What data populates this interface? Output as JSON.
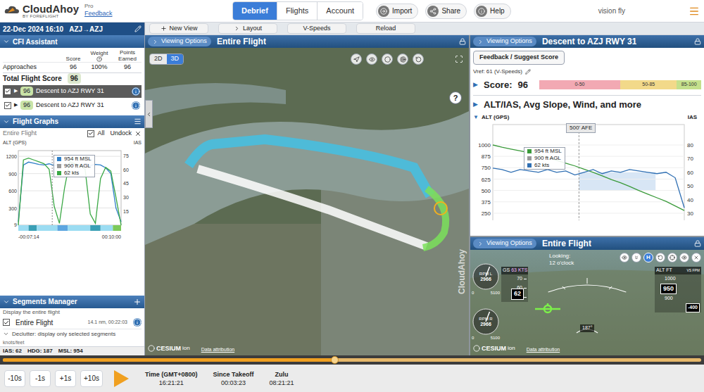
{
  "header": {
    "logo": "CloudAhoy",
    "logo_sub": "BY FOREFLIGHT",
    "edition": "Pro",
    "feedback_link": "Feedback",
    "tabs": [
      {
        "label": "Debrief",
        "selected": true
      },
      {
        "label": "Flights",
        "selected": false
      },
      {
        "label": "Account",
        "selected": false
      }
    ],
    "buttons": [
      "Import",
      "Share",
      "Help"
    ],
    "user": "vision fly"
  },
  "toolbar": [
    "New View",
    "Layout",
    "V-Speeds",
    "Reload"
  ],
  "sidebar": {
    "flight_title": "22-Dec 2024 16:10",
    "route": "AZJ→AZJ",
    "cfi": {
      "title": "CFI Assistant",
      "columns": [
        "Score",
        "Weight",
        "Points Earned"
      ],
      "rows": [
        {
          "label": "Approaches",
          "score": "96",
          "weight": "100%",
          "points": "96"
        }
      ],
      "total": {
        "label": "Total Flight Score",
        "score": "96"
      },
      "segments": [
        {
          "score": "96",
          "label": "Descent to AZJ RWY 31",
          "checked": true,
          "selected": true,
          "expander": "▶"
        },
        {
          "score": "96",
          "label": "Descent to AZJ RWY 31",
          "checked": true,
          "selected": false,
          "expander": "▶"
        }
      ]
    },
    "graphs": {
      "title": "Flight Graphs",
      "filter": "Entire Flight",
      "all": {
        "label": "All",
        "checked": true
      },
      "undock": "Undock",
      "left_axis": "ALT (GPS)",
      "right_axis": "IAS",
      "left_ticks": [
        "1200",
        "900",
        "600",
        "300",
        "9"
      ],
      "right_ticks": [
        "75",
        "60",
        "45",
        "30",
        "15"
      ],
      "x_labels": [
        "-00:07:14",
        "00:10:00"
      ],
      "series": [
        {
          "name": "ALT",
          "color": "#2f7fc8",
          "values": [
            60,
            1050,
            1100,
            1080,
            1060,
            1050,
            1070,
            1040,
            1060,
            1050,
            1030,
            1060,
            1050,
            1070,
            1040,
            1060,
            1050,
            1000,
            900,
            300,
            60
          ]
        },
        {
          "name": "IAS",
          "color": "#3aa845",
          "values": [
            0,
            70,
            72,
            70,
            68,
            66,
            60,
            20,
            2,
            40,
            68,
            66,
            64,
            60,
            12,
            2,
            50,
            62,
            58,
            30,
            0
          ]
        }
      ],
      "tooltip": [
        "954 ft MSL",
        "900 ft AGL",
        "62 kts"
      ],
      "phases": [
        {
          "color": "#9bdcf2",
          "level": 0.1
        },
        {
          "color": "#3a9fb5",
          "level": 0.08
        },
        {
          "color": "#9bdcf2",
          "level": 0.2
        },
        {
          "color": "#5da6e0",
          "level": 0.1
        },
        {
          "color": "#9bdcf2",
          "level": 0.22
        },
        {
          "color": "#3a9fb5",
          "level": 0.1
        },
        {
          "color": "#9bdcf2",
          "level": 0.12
        },
        {
          "color": "#7cc95a",
          "level": 0.08
        }
      ]
    },
    "segments_manager": {
      "title": "Segments Manager",
      "hint": "Display the entire flight",
      "segments": [
        {
          "label": "Entire Flight",
          "detail": "14.1 nm, 00:22:03",
          "checked": true
        }
      ],
      "declutter": "Declutter: display only selected segments",
      "units": "knots/feet"
    },
    "status": [
      {
        "label": "IAS:",
        "value": "62"
      },
      {
        "label": "HDG:",
        "value": "187"
      },
      {
        "label": "MSL:",
        "value": "954"
      }
    ]
  },
  "map_view": {
    "viewing_options": "Viewing Options",
    "title": "Entire Flight",
    "modes": [
      {
        "label": "2D",
        "selected": false
      },
      {
        "label": "3D",
        "selected": true
      }
    ],
    "help": "?",
    "provider": "CESIUM",
    "provider_sub": "ion",
    "attribution": "Data attribution",
    "watermark": "CloudAhoy"
  },
  "score_view": {
    "viewing_options": "Viewing Options",
    "title": "Descent to AZJ RWY 31",
    "feedback_button": "Feedback / Suggest Score",
    "vref": "Vref: 61 (V-Speeds)",
    "score_expander": "▶",
    "score_label": "Score:",
    "score": "96",
    "score_bands": [
      {
        "label": "0-50",
        "color": "#f2a9b3",
        "level": 0.5
      },
      {
        "label": "50-85",
        "color": "#f2d98a",
        "level": 0.35
      },
      {
        "label": "85-100",
        "color": "#c4e08c",
        "level": 0.15
      }
    ],
    "section": {
      "expander": "▶",
      "title": "ALT/IAS, Avg Slope, Wind, and more"
    },
    "chart": {
      "expander": "▼",
      "left_axis": "ALT (GPS)",
      "right_axis": "IAS",
      "left_ticks": [
        "1000",
        "875",
        "750",
        "625",
        "500",
        "375",
        "250"
      ],
      "right_ticks": [
        "80",
        "70",
        "60",
        "50",
        "40",
        "30"
      ],
      "marker": "500' AFE",
      "tooltip": [
        "954 ft MSL",
        "900 ft AGL",
        "62 kts"
      ],
      "series": [
        {
          "name": "ALT",
          "color": "#3a9a3a",
          "values": [
            1000,
            975,
            955,
            935,
            915,
            890,
            860,
            830,
            800,
            770,
            735,
            700,
            660,
            620,
            585,
            545,
            500,
            460,
            420,
            380,
            330,
            280
          ]
        },
        {
          "name": "IAS",
          "color": "#2f6fb3",
          "values": [
            63,
            62,
            60,
            62,
            61,
            60,
            62,
            60,
            61,
            58,
            60,
            62,
            59,
            61,
            60,
            62,
            61,
            60,
            59,
            60,
            56,
            34
          ]
        }
      ]
    }
  },
  "instrument_view": {
    "viewing_options": "Viewing Options",
    "title": "Entire Flight",
    "looking_label": "Looking:",
    "looking": "12 o'clock",
    "view_buttons": [
      {
        "kind": "icon",
        "label": "",
        "selected": false
      },
      {
        "kind": "icon",
        "label": "",
        "selected": false
      },
      {
        "kind": "text",
        "label": "H",
        "selected": true
      },
      {
        "kind": "icon",
        "label": "",
        "selected": false
      },
      {
        "kind": "icon",
        "label": "",
        "selected": false
      },
      {
        "kind": "icon",
        "label": "",
        "selected": false
      },
      {
        "kind": "icon",
        "label": "",
        "selected": false
      }
    ],
    "ground_speed": {
      "label": "GS",
      "value": "63",
      "unit": "KTS",
      "ticks": [
        "70",
        "60",
        "50"
      ],
      "reading": "62"
    },
    "rpm": [
      {
        "label": "RPM L",
        "value": "2966",
        "min": "0",
        "max": "5100",
        "level": 0.58
      },
      {
        "label": "RPM R",
        "value": "2966",
        "min": "0",
        "max": "5100",
        "level": 0.58
      }
    ],
    "altitude": {
      "label": "ALT FT",
      "vs_label": "VS FPM",
      "ticks": [
        "1000",
        "900"
      ],
      "reading": "950",
      "vs": "-400"
    },
    "heading": "187°",
    "provider": "CESIUM",
    "provider_sub": "ion",
    "attribution": "Data attribution"
  },
  "timeline": {
    "level": 0.475,
    "steps": [
      "-10s",
      "-1s",
      "+1s",
      "+10s"
    ],
    "clocks": [
      {
        "label": "Time (GMT+0800)",
        "value": "16:21:21"
      },
      {
        "label": "Since Takeoff",
        "value": "00:03:23"
      },
      {
        "label": "Zulu",
        "value": "08:21:21"
      }
    ]
  }
}
